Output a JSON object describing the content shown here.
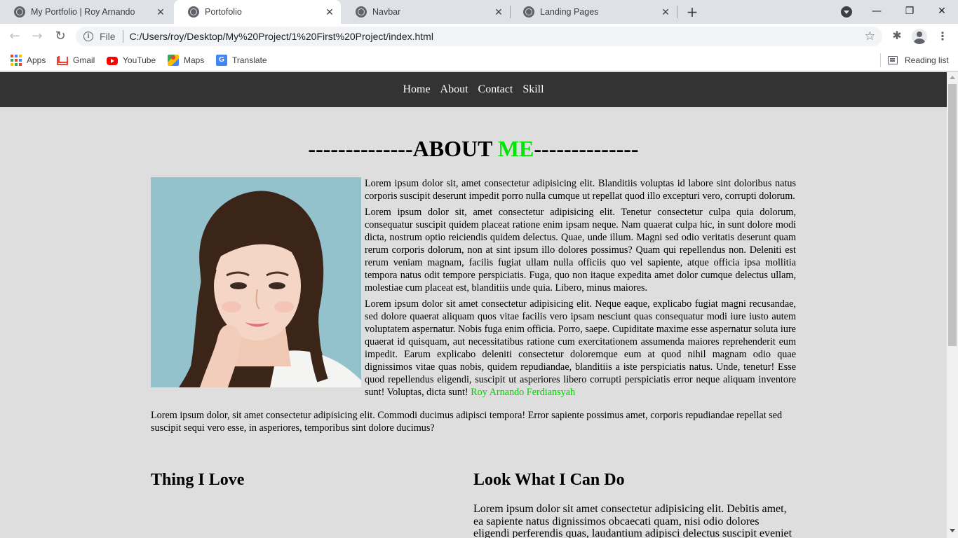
{
  "browser": {
    "tabs": [
      {
        "title": "My Portfolio | Roy Arnando",
        "active": false
      },
      {
        "title": "Portofolio",
        "active": true
      },
      {
        "title": "Navbar",
        "active": false
      },
      {
        "title": "Landing Pages",
        "active": false
      }
    ],
    "address": {
      "scheme_label": "File",
      "url": "C:/Users/roy/Desktop/My%20Project/1%20First%20Project/index.html"
    },
    "bookmarks": [
      "Apps",
      "Gmail",
      "YouTube",
      "Maps",
      "Translate"
    ],
    "reading_list": "Reading list",
    "icons": {
      "back": "arrow-left-icon",
      "forward": "arrow-right-icon",
      "reload": "reload-icon",
      "star": "star-icon",
      "extensions": "puzzle-icon",
      "profile": "profile-icon",
      "menu": "kebab-menu-icon"
    }
  },
  "page": {
    "nav": [
      "Home",
      "About",
      "Contact",
      "Skill"
    ],
    "about_title": {
      "dashes_left": "--------------",
      "word": "ABOUT ",
      "accent": "ME",
      "dashes_right": "--------------"
    },
    "paragraphs": [
      "Lorem ipsum dolor sit, amet consectetur adipisicing elit. Blanditiis voluptas id labore sint doloribus natus corporis suscipit deserunt impedit porro nulla cumque ut repellat quod illo excepturi vero, corrupti dolorum.",
      "Lorem ipsum dolor sit, amet consectetur adipisicing elit. Tenetur consectetur culpa quia dolorum, consequatur suscipit quidem placeat ratione enim ipsam neque. Nam quaerat culpa hic, in sunt dolore modi dicta, nostrum optio reiciendis quidem delectus. Quae, unde illum. Magni sed odio veritatis deserunt quam rerum corporis dolorum, non at sint ipsum illo dolores possimus? Quam qui repellendus non. Deleniti est rerum veniam magnam, facilis fugiat ullam nulla officiis quo vel sapiente, atque officia ipsa mollitia tempora natus odit tempore perspiciatis. Fuga, quo non itaque expedita amet dolor cumque delectus ullam, molestiae cum placeat est, blanditiis unde quia. Libero, minus maiores.",
      "Lorem ipsum dolor sit amet consectetur adipisicing elit. Neque eaque, explicabo fugiat magni recusandae, sed dolore quaerat aliquam quos vitae facilis vero ipsam nesciunt quas consequatur modi iure iusto autem voluptatem aspernatur. Nobis fuga enim officia. Porro, saepe. Cupiditate maxime esse aspernatur soluta iure quaerat id quisquam, aut necessitatibus ratione cum exercitationem assumenda maiores reprehenderit eum impedit. Earum explicabo deleniti consectetur doloremque eum at quod nihil magnam odio quae dignissimos vitae quas nobis, quidem repudiandae, blanditiis a iste perspiciatis natus. Unde, tenetur! Esse quod repellendus eligendi, suscipit ut asperiores libero corrupti perspiciatis error neque aliquam inventore sunt! Voluptas, dicta sunt!"
    ],
    "author_name": "Roy Arnando Ferdiansyah",
    "paragraph4": "Lorem ipsum dolor, sit amet consectetur adipisicing elit. Commodi ducimus adipisci tempora! Error sapiente possimus amet, corporis repudiandae repellat sed suscipit sequi vero esse, in asperiores, temporibus sint dolore ducimus?",
    "section_left_title": "Thing I Love",
    "section_right_title": "Look What I Can Do",
    "section_right_text": "Lorem ipsum dolor sit amet consectetur adipisicing elit. Debitis amet, ea sapiente natus dignissimos obcaecati quam, nisi odio dolores eligendi perferendis quas, laudantium adipisci delectus suscipit eveniet",
    "colors": {
      "accent": "#00e600",
      "navbar": "#333333",
      "background": "#dedede"
    }
  }
}
